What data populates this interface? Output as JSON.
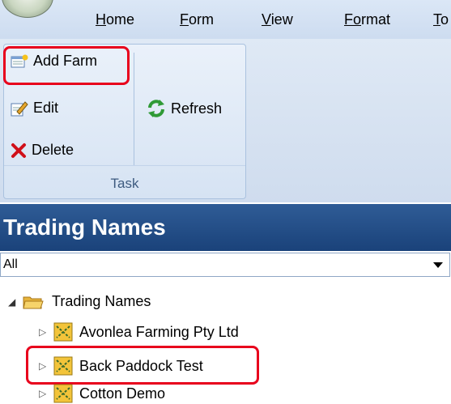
{
  "menu": {
    "items": [
      {
        "label": "H",
        "rest": "ome"
      },
      {
        "label": "F",
        "rest": "orm"
      },
      {
        "label": "V",
        "rest": "iew"
      },
      {
        "label": "Fo",
        "rest": "rmat"
      },
      {
        "label": "T",
        "rest": "o"
      }
    ]
  },
  "ribbon": {
    "add_farm": "Add Farm",
    "edit": "Edit",
    "delete": "Delete",
    "refresh": "Refresh",
    "group_label": "Task"
  },
  "panel": {
    "title": "Trading Names",
    "filter_value": "All"
  },
  "tree": {
    "root": "Trading Names",
    "items": [
      "Avonlea Farming Pty Ltd",
      "Back Paddock Test",
      "Cotton Demo"
    ]
  },
  "colors": {
    "highlight": "#e8001c",
    "panel_header": "#1f4a85",
    "ribbon_bg": "#dbe7f6"
  }
}
